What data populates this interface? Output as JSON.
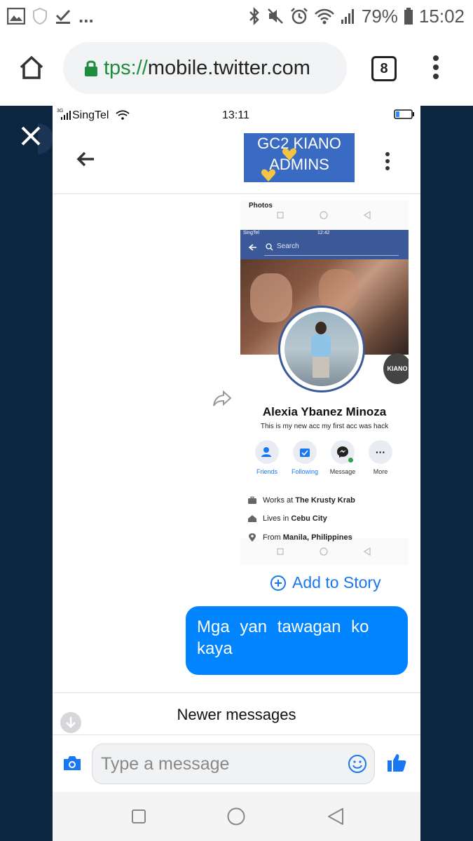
{
  "android_status": {
    "battery": "79%",
    "time": "15:02"
  },
  "browser": {
    "url_scheme": "tps://",
    "url_host": "mobile.twitter.com",
    "tab_count": "8"
  },
  "phone_status": {
    "carrier": "SingTel",
    "network": "3G",
    "time": "13:11"
  },
  "chat": {
    "group_name_line1": "GC2    KIANO",
    "group_name_line2": "ADMINS",
    "shared_photo": {
      "top_label": "Photos",
      "fb_status_carrier": "SingTel",
      "fb_status_time": "12:42",
      "search_placeholder": "Search",
      "profile_name": "Alexia Ybanez Minoza",
      "profile_bio": "This is my new acc my first acc was hack",
      "actions": [
        "Friends",
        "Following",
        "Message",
        "More"
      ],
      "works_label": "Works at",
      "works_value": "The Krusty Krab",
      "lives_label": "Lives in",
      "lives_value": "Cebu City",
      "from_label": "From",
      "from_value": "Manila, Philippines",
      "badge_text": "KIANO"
    },
    "add_to_story": "Add to Story",
    "message_text": "Mga yan tawagan ko kaya",
    "newer_messages": "Newer messages",
    "composer_placeholder": "Type a message"
  },
  "colors": {
    "messenger_blue": "#0084ff",
    "facebook_blue": "#3b5998",
    "viewer_background": "#0d2640"
  }
}
